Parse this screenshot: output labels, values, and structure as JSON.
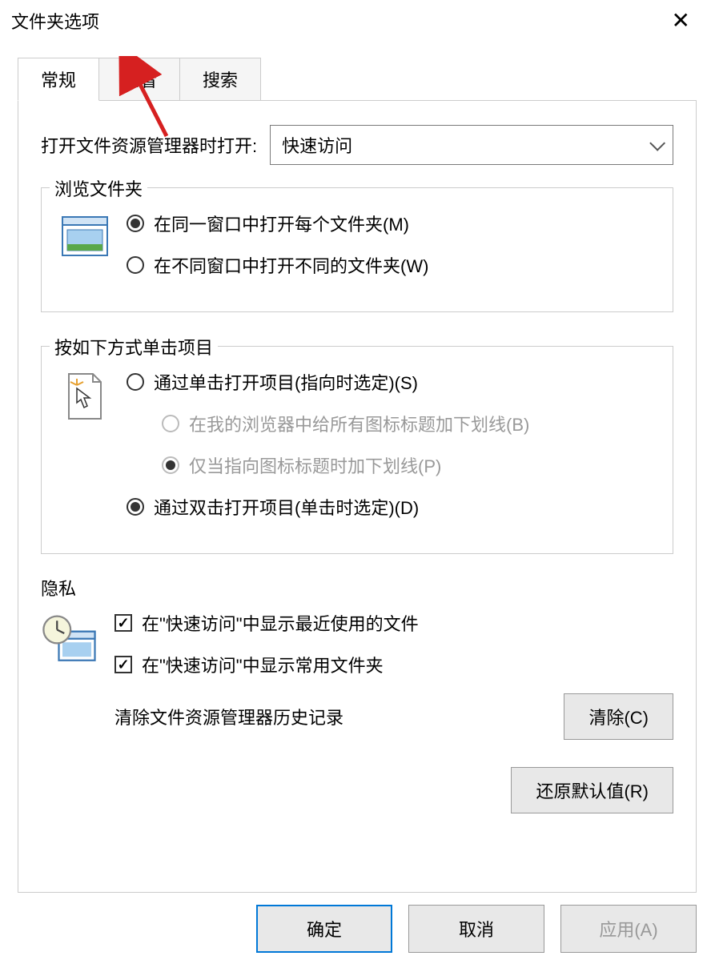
{
  "window": {
    "title": "文件夹选项",
    "close_icon": "✕"
  },
  "tabs": [
    {
      "label": "常规",
      "active": true
    },
    {
      "label": "查看",
      "active": false
    },
    {
      "label": "搜索",
      "active": false
    }
  ],
  "open_with": {
    "label": "打开文件资源管理器时打开:",
    "selected": "快速访问"
  },
  "browse_folders": {
    "legend": "浏览文件夹",
    "options": [
      {
        "label": "在同一窗口中打开每个文件夹(M)",
        "checked": true
      },
      {
        "label": "在不同窗口中打开不同的文件夹(W)",
        "checked": false
      }
    ]
  },
  "click_items": {
    "legend": "按如下方式单击项目",
    "options": [
      {
        "label": "通过单击打开项目(指向时选定)(S)",
        "checked": false,
        "sub": false
      },
      {
        "label": "在我的浏览器中给所有图标标题加下划线(B)",
        "checked": false,
        "sub": true
      },
      {
        "label": "仅当指向图标标题时加下划线(P)",
        "checked": true,
        "sub": true
      },
      {
        "label": "通过双击打开项目(单击时选定)(D)",
        "checked": true,
        "sub": false
      }
    ]
  },
  "privacy": {
    "legend": "隐私",
    "checks": [
      {
        "label": "在\"快速访问\"中显示最近使用的文件",
        "checked": true
      },
      {
        "label": "在\"快速访问\"中显示常用文件夹",
        "checked": true
      }
    ],
    "clear_label": "清除文件资源管理器历史记录",
    "clear_button": "清除(C)"
  },
  "restore_button": "还原默认值(R)",
  "footer": {
    "ok": "确定",
    "cancel": "取消",
    "apply": "应用(A)"
  }
}
